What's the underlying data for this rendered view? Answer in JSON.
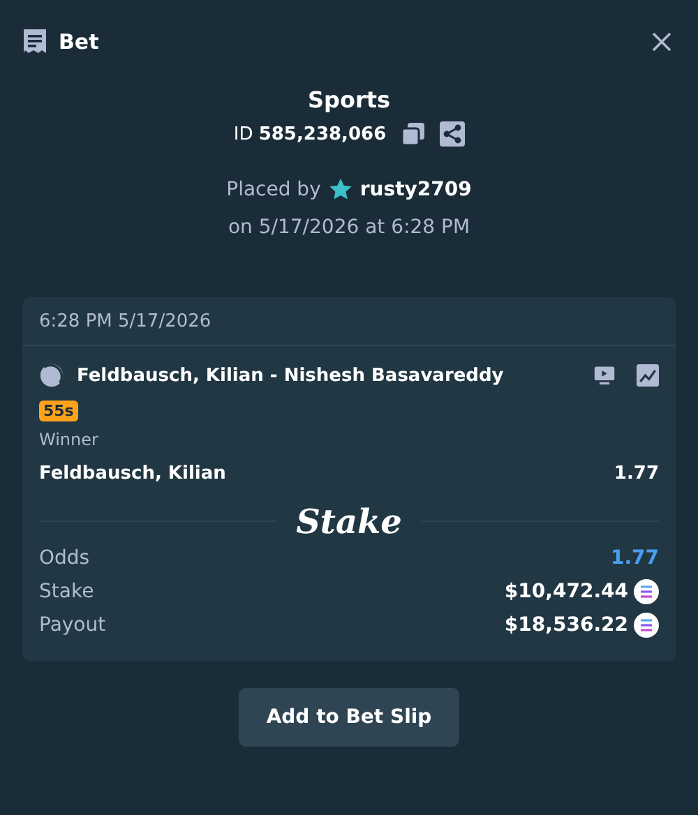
{
  "header": {
    "title": "Bet"
  },
  "bet": {
    "category": "Sports",
    "id_label": "ID",
    "id_value": "585,238,066",
    "placed_by_label": "Placed by",
    "user": "rusty2709",
    "placed_on": "on 5/17/2026 at 6:28 PM"
  },
  "card": {
    "time": "6:28 PM 5/17/2026",
    "event": "Feldbausch, Kilian - Nishesh Basavareddy",
    "badge": "55s",
    "market": "Winner",
    "selection": "Feldbausch, Kilian",
    "selection_odds": "1.77",
    "brand": "Stake",
    "summary": [
      {
        "label": "Odds",
        "value": "1.77",
        "kind": "odds"
      },
      {
        "label": "Stake",
        "value": "$10,472.44",
        "kind": "amount"
      },
      {
        "label": "Payout",
        "value": "$18,536.22",
        "kind": "amount"
      }
    ]
  },
  "action": "Add to Bet Slip"
}
